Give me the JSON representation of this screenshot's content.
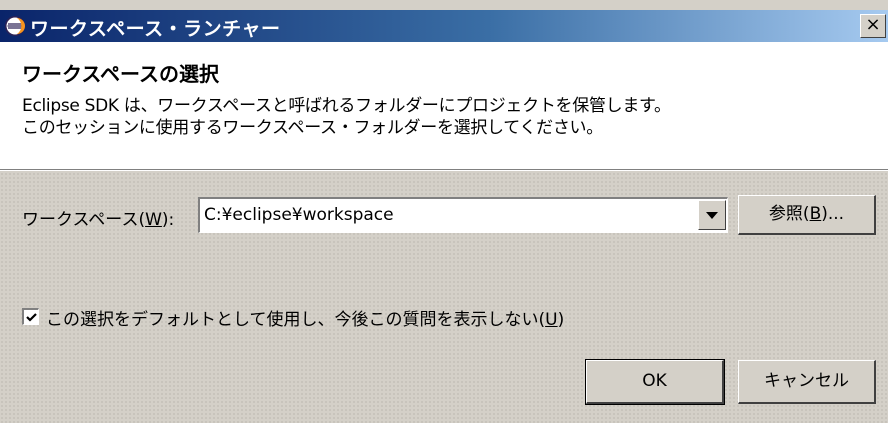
{
  "window": {
    "title": "ワークスペース・ランチャー",
    "close_label": "×"
  },
  "header": {
    "title": "ワークスペースの選択",
    "description_line1": "Eclipse SDK は、ワークスペースと呼ばれるフォルダーにプロジェクトを保管します。",
    "description_line2": "このセッションに使用するワークスペース・フォルダーを選択してください。"
  },
  "workspace": {
    "label_prefix": "ワークスペース(",
    "label_key": "W",
    "label_suffix": "):",
    "value": "C:¥eclipse¥workspace"
  },
  "buttons": {
    "browse_prefix": "参照(",
    "browse_key": "B",
    "browse_suffix": ")...",
    "ok": "OK",
    "cancel": "キャンセル"
  },
  "default_checkbox": {
    "checked": true,
    "label_prefix": "この選択をデフォルトとして使用し、今後この質問を表示しない(",
    "label_key": "U",
    "label_suffix": ")"
  },
  "icons": {
    "app": "eclipse-icon",
    "close": "close-icon",
    "dropdown": "chevron-down-icon",
    "check": "checkmark-icon"
  },
  "colors": {
    "titlebar_start": "#0a246a",
    "titlebar_end": "#a6caf0",
    "dialog_bg": "#d4d0c8"
  }
}
